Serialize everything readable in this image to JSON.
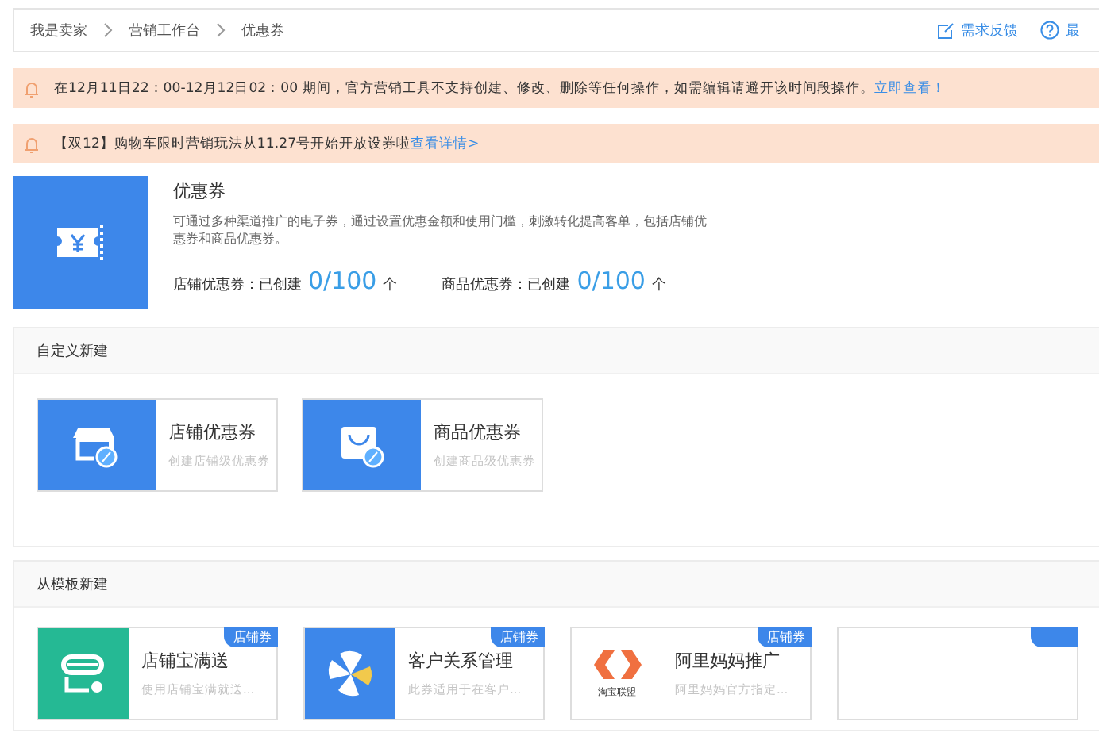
{
  "breadcrumb": {
    "items": [
      "我是卖家",
      "营销工作台",
      "优惠券"
    ],
    "links": [
      "需求反馈",
      "最"
    ]
  },
  "notices": [
    {
      "text": "在12月11日22：00-12月12日02：00 期间，官方营销工具不支持创建、修改、删除等任何操作，如需编辑请避开该时间段操作。",
      "link": "立即查看！"
    },
    {
      "text": "【双12】购物车限时营销玩法从11.27号开始开放设券啦",
      "link": "查看详情>"
    }
  ],
  "intro": {
    "title": "优惠券",
    "description": "可通过多种渠道推广的电子券，通过设置优惠金额和使用门槛，刺激转化提高客单，包括店铺优惠券和商品优惠券。",
    "stats": [
      {
        "label": "店铺优惠券：已创建",
        "value": "0/100",
        "unit": "个"
      },
      {
        "label": "商品优惠券：已创建",
        "value": "0/100",
        "unit": "个"
      }
    ]
  },
  "custom_section": {
    "title": "自定义新建",
    "cards": [
      {
        "kind": "shop",
        "title": "店铺优惠券",
        "subtitle": "创建店铺级优惠券"
      },
      {
        "kind": "bag",
        "title": "商品优惠券",
        "subtitle": "创建商品级优惠券"
      }
    ]
  },
  "template_section": {
    "title": "从模板新建",
    "cards": [
      {
        "kind": "shopgift",
        "title": "店铺宝满送",
        "subtitle": "使用店铺宝满就送...",
        "badge": "店铺券"
      },
      {
        "kind": "pinwheel",
        "title": "客户关系管理",
        "subtitle": "此券适用于在客户...",
        "badge": "店铺券"
      },
      {
        "kind": "alliance",
        "title": "阿里妈妈推广",
        "subtitle": "阿里妈妈官方指定...",
        "badge": "店铺券",
        "logo_text": "淘宝联盟"
      },
      {
        "kind": "blank"
      }
    ]
  }
}
